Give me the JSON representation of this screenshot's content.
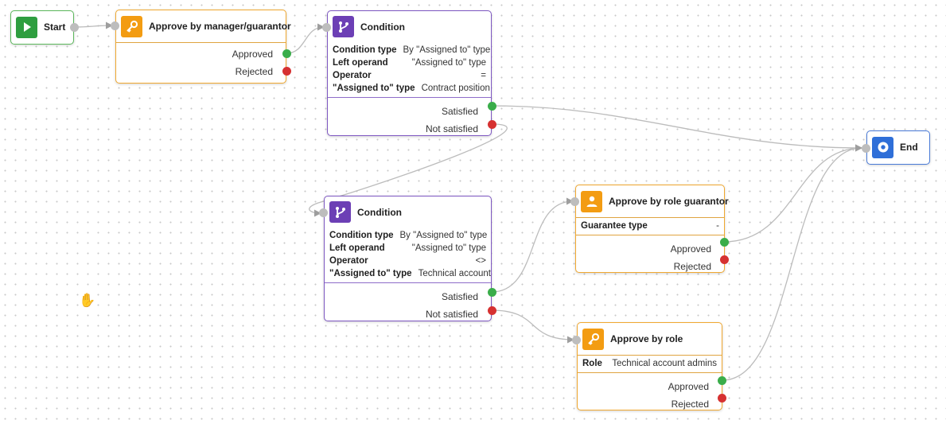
{
  "nodes": {
    "start": {
      "title": "Start"
    },
    "approve_manager": {
      "title": "Approve by manager/guarantor",
      "outputs": {
        "approved": "Approved",
        "rejected": "Rejected"
      }
    },
    "condition1": {
      "title": "Condition",
      "props": [
        {
          "k": "Condition type",
          "v": "By \"Assigned to\" type"
        },
        {
          "k": "Left operand",
          "v": "\"Assigned to\" type"
        },
        {
          "k": "Operator",
          "v": "="
        },
        {
          "k": "\"Assigned to\" type",
          "v": "Contract position"
        }
      ],
      "outputs": {
        "satisfied": "Satisfied",
        "not_satisfied": "Not satisfied"
      }
    },
    "condition2": {
      "title": "Condition",
      "props": [
        {
          "k": "Condition type",
          "v": "By \"Assigned to\" type"
        },
        {
          "k": "Left operand",
          "v": "\"Assigned to\" type"
        },
        {
          "k": "Operator",
          "v": "<>"
        },
        {
          "k": "\"Assigned to\" type",
          "v": "Technical account"
        }
      ],
      "outputs": {
        "satisfied": "Satisfied",
        "not_satisfied": "Not satisfied"
      }
    },
    "approve_role_guarantor": {
      "title": "Approve by role guarantor",
      "props": [
        {
          "k": "Guarantee type",
          "v": "-"
        }
      ],
      "outputs": {
        "approved": "Approved",
        "rejected": "Rejected"
      }
    },
    "approve_role": {
      "title": "Approve by role",
      "props": [
        {
          "k": "Role",
          "v": "Technical account admins"
        }
      ],
      "outputs": {
        "approved": "Approved",
        "rejected": "Rejected"
      }
    },
    "end": {
      "title": "End"
    }
  },
  "colors": {
    "start": "#2e9e3f",
    "approve": "#f39c12",
    "condition": "#6c3fb5",
    "end": "#2f6fd8",
    "port_ok": "#3aad4a",
    "port_bad": "#d63131",
    "port_in": "#bdbdbd",
    "edge": "#bcbcbc"
  },
  "icons": {
    "start": "play-icon",
    "approve_manager": "key-icon",
    "condition": "branch-icon",
    "approve_role_guarantor": "person-icon",
    "approve_role": "key-icon",
    "end": "stop-circle-icon"
  }
}
